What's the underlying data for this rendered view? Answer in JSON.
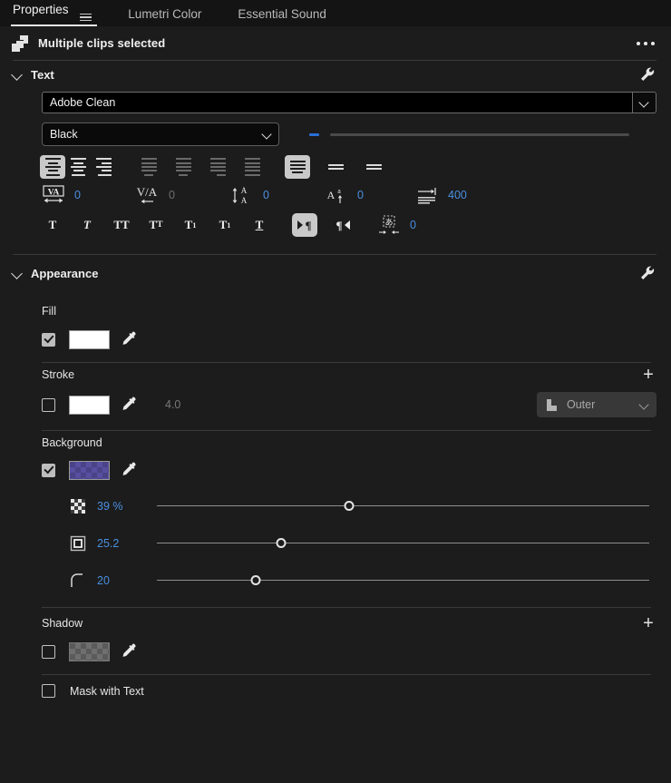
{
  "tabs": [
    {
      "label": "Properties",
      "active": true,
      "menu_icon": "hamburger-icon"
    },
    {
      "label": "Lumetri Color",
      "active": false
    },
    {
      "label": "Essential Sound",
      "active": false
    }
  ],
  "header": {
    "icon": "multiple-clips-icon",
    "title": "Multiple clips selected",
    "overflow_icon": "more-options-icon"
  },
  "sections": {
    "text": {
      "title": "Text",
      "collapse_icon": "chevron-down-icon",
      "settings_icon": "wrench-icon",
      "font_family": {
        "value": "Adobe Clean",
        "dropdown_icon": "chevron-down-icon"
      },
      "font_style": {
        "value": "Black",
        "dropdown_icon": "chevron-down-icon"
      },
      "font_size": {
        "value": "",
        "mixed_indicator": true
      },
      "align_buttons": [
        {
          "name": "align-left",
          "icon": "align-left-icon",
          "selected": true,
          "dimmed": false
        },
        {
          "name": "align-center",
          "icon": "align-center-icon",
          "selected": false,
          "dimmed": false
        },
        {
          "name": "align-right",
          "icon": "align-right-icon",
          "selected": false,
          "dimmed": false
        },
        {
          "name": "justify-last-left",
          "icon": "justify-last-left-icon",
          "selected": false,
          "dimmed": true
        },
        {
          "name": "justify-last-center",
          "icon": "justify-last-center-icon",
          "selected": false,
          "dimmed": true
        },
        {
          "name": "justify-last-right",
          "icon": "justify-last-right-icon",
          "selected": false,
          "dimmed": true
        },
        {
          "name": "justify-all",
          "icon": "justify-all-icon",
          "selected": false,
          "dimmed": true
        },
        {
          "name": "vertical-align-top",
          "icon": "vertical-align-top-icon",
          "selected": true,
          "dimmed": false
        },
        {
          "name": "vertical-align-center",
          "icon": "vertical-align-center-icon",
          "selected": false,
          "dimmed": false
        },
        {
          "name": "vertical-align-bottom",
          "icon": "vertical-align-bottom-icon",
          "selected": false,
          "dimmed": false
        }
      ],
      "metrics": [
        {
          "name": "tracking",
          "icon": "tracking-icon",
          "value": "0",
          "dimmed": false
        },
        {
          "name": "kerning",
          "icon": "kerning-icon",
          "value": "0",
          "dimmed": true
        },
        {
          "name": "leading",
          "icon": "leading-icon",
          "value": "0",
          "dimmed": false
        },
        {
          "name": "baseline-shift",
          "icon": "baseline-shift-icon",
          "value": "0",
          "dimmed": false
        },
        {
          "name": "text-width",
          "icon": "text-width-icon",
          "value": "400",
          "dimmed": false
        }
      ],
      "style_buttons": [
        {
          "name": "bold",
          "glyph": "T",
          "variant": "bold",
          "selected": false
        },
        {
          "name": "italic",
          "glyph": "T",
          "variant": "italic",
          "selected": false
        },
        {
          "name": "all-caps",
          "glyph": "TT",
          "variant": "caps",
          "selected": false
        },
        {
          "name": "small-caps",
          "glyph": "TT",
          "variant": "smallcaps",
          "selected": false
        },
        {
          "name": "superscript",
          "glyph": "T",
          "variant": "superscript",
          "selected": false
        },
        {
          "name": "subscript",
          "glyph": "T",
          "variant": "subscript",
          "selected": false
        },
        {
          "name": "underline",
          "glyph": "T",
          "variant": "underline",
          "selected": false
        }
      ],
      "direction_buttons": [
        {
          "name": "text-direction-ltr",
          "icon": "text-direction-ltr-icon",
          "selected": true
        },
        {
          "name": "text-direction-rtl",
          "icon": "text-direction-rtl-icon",
          "selected": false
        }
      ],
      "tsume": {
        "icon": "tsume-icon",
        "value": "0"
      }
    },
    "appearance": {
      "title": "Appearance",
      "collapse_icon": "chevron-down-icon",
      "settings_icon": "wrench-icon",
      "fill": {
        "label": "Fill",
        "enabled": true,
        "swatch_color": "#ffffff",
        "eyedropper_icon": "eyedropper-icon"
      },
      "stroke": {
        "label": "Stroke",
        "add_icon": "plus-icon",
        "enabled": false,
        "swatch_color": "#ffffff",
        "eyedropper_icon": "eyedropper-icon",
        "width": "4.0",
        "position": {
          "value": "Outer",
          "icon": "stroke-position-icon",
          "dropdown_icon": "chevron-down-icon"
        }
      },
      "background": {
        "label": "Background",
        "enabled": true,
        "swatch_color": "#574fa0",
        "eyedropper_icon": "eyedropper-icon",
        "sliders": [
          {
            "name": "background-opacity",
            "icon": "opacity-icon",
            "value": "39 %",
            "percent": 39
          },
          {
            "name": "background-size",
            "icon": "size-icon",
            "value": "25.2",
            "percent": 25.2
          },
          {
            "name": "background-corner-radius",
            "icon": "corner-radius-icon",
            "value": "20",
            "percent": 20
          }
        ]
      },
      "shadow": {
        "label": "Shadow",
        "add_icon": "plus-icon",
        "enabled": false,
        "swatch_color": "#5a5a5a",
        "eyedropper_icon": "eyedropper-icon"
      },
      "mask_with_text": {
        "label": "Mask with Text",
        "enabled": false
      }
    }
  },
  "colors": {
    "panel_bg": "#1c1c1c",
    "tabbar_bg": "#141414",
    "accent_value": "#4a8fe0",
    "selected_button": "#c9c9c9",
    "divider": "#3a3a3a"
  }
}
